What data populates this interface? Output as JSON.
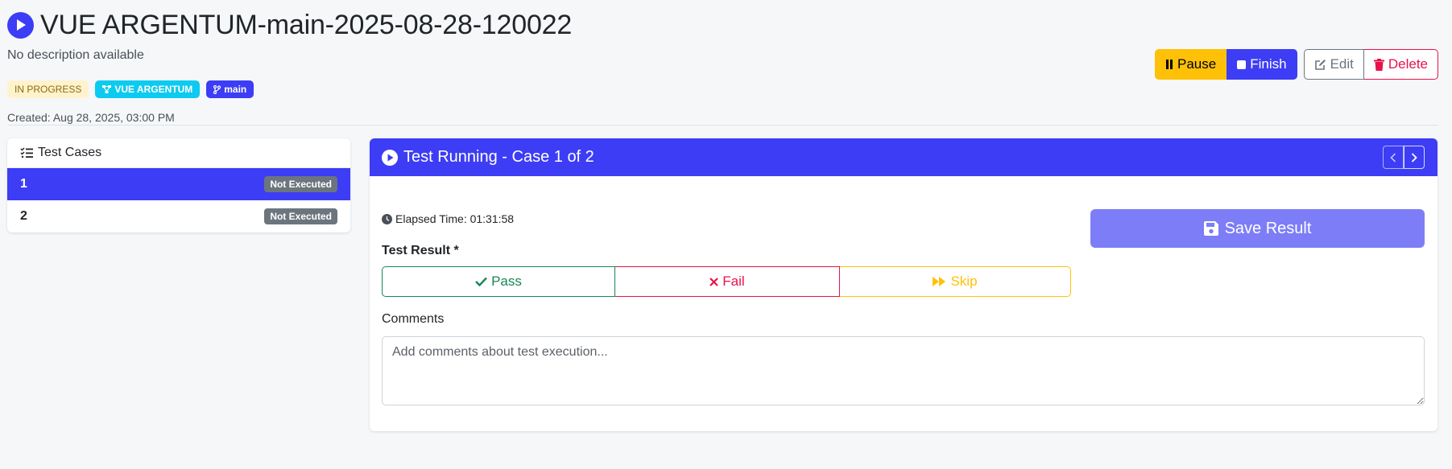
{
  "header": {
    "title": "VUE ARGENTUM-main-2025-08-28-120022",
    "description": "No description available",
    "status_badge": "IN PROGRESS",
    "project_badge": "VUE ARGENTUM",
    "branch_badge": "main",
    "created": "Created: Aug 28, 2025, 03:00 PM"
  },
  "actions": {
    "pause": "Pause",
    "finish": "Finish",
    "edit": "Edit",
    "delete": "Delete"
  },
  "sidebar": {
    "title": "Test Cases",
    "items": [
      {
        "label": "1",
        "status": "Not Executed",
        "active": true
      },
      {
        "label": "2",
        "status": "Not Executed",
        "active": false
      }
    ]
  },
  "main": {
    "header_title": "Test Running - Case 1 of 2",
    "elapsed": "Elapsed Time: 01:31:58",
    "result_label": "Test Result *",
    "pass": "Pass",
    "fail": "Fail",
    "skip": "Skip",
    "save": "Save Result",
    "comments_label": "Comments",
    "comments_placeholder": "Add comments about test execution...",
    "comments_value": ""
  },
  "colors": {
    "primary": "#3d3df5",
    "warning": "#ffc107",
    "danger": "#e8124a",
    "success": "#198754",
    "info": "#0dcaf0",
    "secondary": "#6c757d"
  }
}
